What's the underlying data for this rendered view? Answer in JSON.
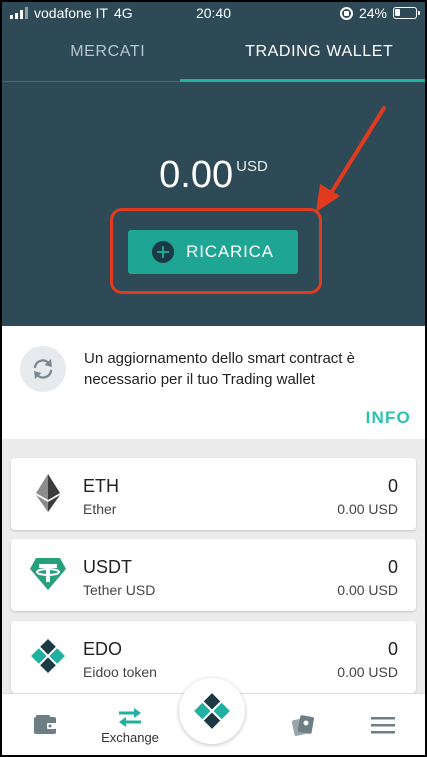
{
  "status_bar": {
    "carrier": "vodafone IT",
    "network": "4G",
    "time": "20:40",
    "battery": "24%",
    "battery_level": 0.24
  },
  "tabs": [
    {
      "label": "MERCATI",
      "active": false
    },
    {
      "label": "TRADING WALLET",
      "active": true
    }
  ],
  "wallet": {
    "balance": "0.00",
    "currency": "USD",
    "recharge_label": "RICARICA"
  },
  "notice": {
    "message": "Un aggiornamento dello smart contract è necessario per il tuo Trading wallet",
    "info_label": "INFO"
  },
  "tokens": [
    {
      "symbol": "ETH",
      "name": "Ether",
      "amount": "0",
      "usd_value": "0.00 USD",
      "icon": "ethereum-icon"
    },
    {
      "symbol": "USDT",
      "name": "Tether USD",
      "amount": "0",
      "usd_value": "0.00 USD",
      "icon": "tether-icon"
    },
    {
      "symbol": "EDO",
      "name": "Eidoo token",
      "amount": "0",
      "usd_value": "0.00 USD",
      "icon": "eidoo-icon"
    }
  ],
  "bottom_nav": {
    "wallet_icon": "wallet-icon",
    "exchange_label": "Exchange",
    "center_icon": "eidoo-logo-icon",
    "cards_icon": "cards-icon",
    "menu_icon": "menu-icon"
  },
  "colors": {
    "header_bg": "#2e4a56",
    "accent": "#1fa594",
    "info_text": "#2cc2b0",
    "annotation": "#e23a1e"
  }
}
